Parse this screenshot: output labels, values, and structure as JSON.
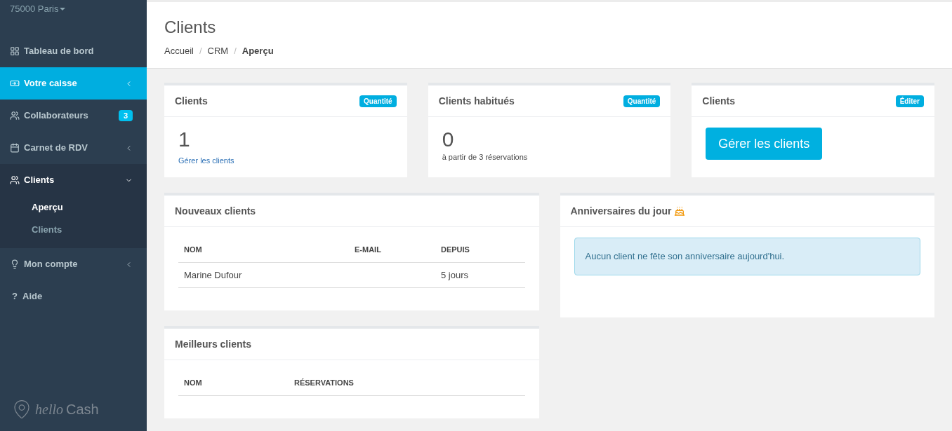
{
  "sidebar": {
    "location": "75000 Paris",
    "items": [
      {
        "kind": "dashboard",
        "label": "Tableau de bord",
        "selected": false
      },
      {
        "kind": "cash",
        "label": "Votre caisse",
        "selected": true,
        "expanded": false
      },
      {
        "kind": "team",
        "label": "Collaborateurs",
        "selected": false,
        "badge": "3"
      },
      {
        "kind": "calendar",
        "label": "Carnet de RDV",
        "selected": false,
        "expanded": false
      },
      {
        "kind": "clients",
        "label": "Clients",
        "selected": false,
        "expanded": true,
        "children": [
          {
            "label": "Aperçu",
            "selected": true
          },
          {
            "label": "Clients",
            "selected": false
          }
        ]
      },
      {
        "kind": "account",
        "label": "Mon compte",
        "selected": false,
        "expanded": false
      },
      {
        "kind": "help",
        "glyph": "?",
        "label": "Aide",
        "selected": false
      }
    ],
    "logo": {
      "script": "hello",
      "word": "Cash"
    }
  },
  "header": {
    "title": "Clients",
    "breadcrumb": [
      "Accueil",
      "CRM",
      "Aperçu"
    ],
    "separator": "/"
  },
  "stat_cards": [
    {
      "kind": "stat",
      "title": "Clients",
      "badge": "Quantité",
      "value": "1",
      "link": "Gérer les clients"
    },
    {
      "kind": "stat",
      "title": "Clients habitués",
      "badge": "Quantité",
      "value": "0",
      "note": "à partir de 3 réservations"
    },
    {
      "kind": "action",
      "title": "Clients",
      "badge": "Éditer",
      "button": "Gérer les clients"
    }
  ],
  "new_clients": {
    "title": "Nouveaux clients",
    "columns": [
      "NOM",
      "E-MAIL",
      "DEPUIS"
    ],
    "rows": [
      [
        "Marine Dufour",
        "",
        "5 jours"
      ]
    ]
  },
  "best_clients": {
    "title": "Meilleurs clients",
    "columns": [
      "NOM",
      "RÉSERVATIONS"
    ]
  },
  "birthdays": {
    "title": "Anniversaires du jour",
    "message": "Aucun client ne fête son anniversaire aujourd'hui."
  }
}
